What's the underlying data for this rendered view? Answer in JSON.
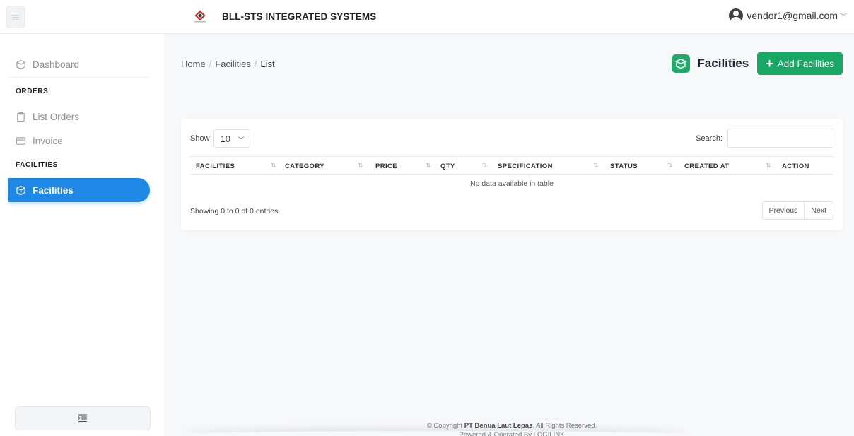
{
  "app": {
    "title": "BLL-STS INTEGRATED SYSTEMS"
  },
  "user": {
    "email": "vendor1@gmail.com"
  },
  "sidebar": {
    "dashboard_label": "Dashboard",
    "orders_heading": "ORDERS",
    "list_orders_label": "List Orders",
    "invoice_label": "Invoice",
    "facilities_heading": "FACILITIES",
    "facilities_label": "Facilities"
  },
  "breadcrumb": {
    "home": "Home",
    "section": "Facilities",
    "current": "List"
  },
  "page": {
    "title": "Facilities",
    "add_button": "Add Facilities"
  },
  "table": {
    "show_label": "Show",
    "page_length": "10",
    "search_label": "Search:",
    "columns": [
      "FACILITIES",
      "CATEGORY",
      "PRICE",
      "QTY",
      "SPECIFICATION",
      "STATUS",
      "CREATED AT",
      "ACTION"
    ],
    "empty_message": "No data available in table",
    "info": "Showing 0 to 0 of 0 entries",
    "prev_label": "Previous",
    "next_label": "Next"
  },
  "footer": {
    "copyright_prefix": "© Copyright ",
    "company": "PT Benua Laut Lepas",
    "copyright_suffix": ". All Rights Reserved.",
    "powered": "Powered & Operated By LOGILINK"
  },
  "colors": {
    "primary": "#1f87e5",
    "success": "#18a865"
  },
  "icons": {
    "dashboard": "cube-icon",
    "list_orders": "clipboard-icon",
    "invoice": "card-icon",
    "facilities": "cube-icon",
    "page": "box-icon",
    "user": "user-circle-icon"
  }
}
